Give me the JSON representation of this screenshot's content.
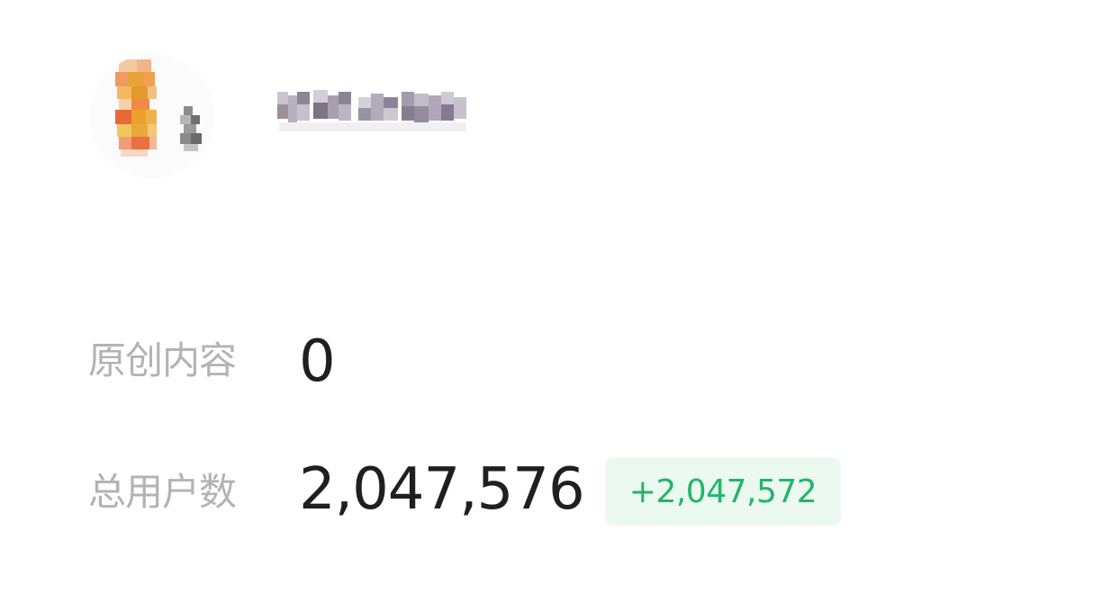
{
  "profile": {
    "avatar_icon": "pixelated-avatar-icon",
    "name_blurred": true
  },
  "stats": {
    "original_content": {
      "label": "原创内容",
      "value": "0"
    },
    "total_users": {
      "label": "总用户数",
      "value": "2,047,576",
      "delta": "+2,047,572"
    }
  },
  "colors": {
    "label": "#b3b3b3",
    "value": "#1f1f1f",
    "delta_text": "#21b66a",
    "delta_bg": "#ebf9f1"
  }
}
